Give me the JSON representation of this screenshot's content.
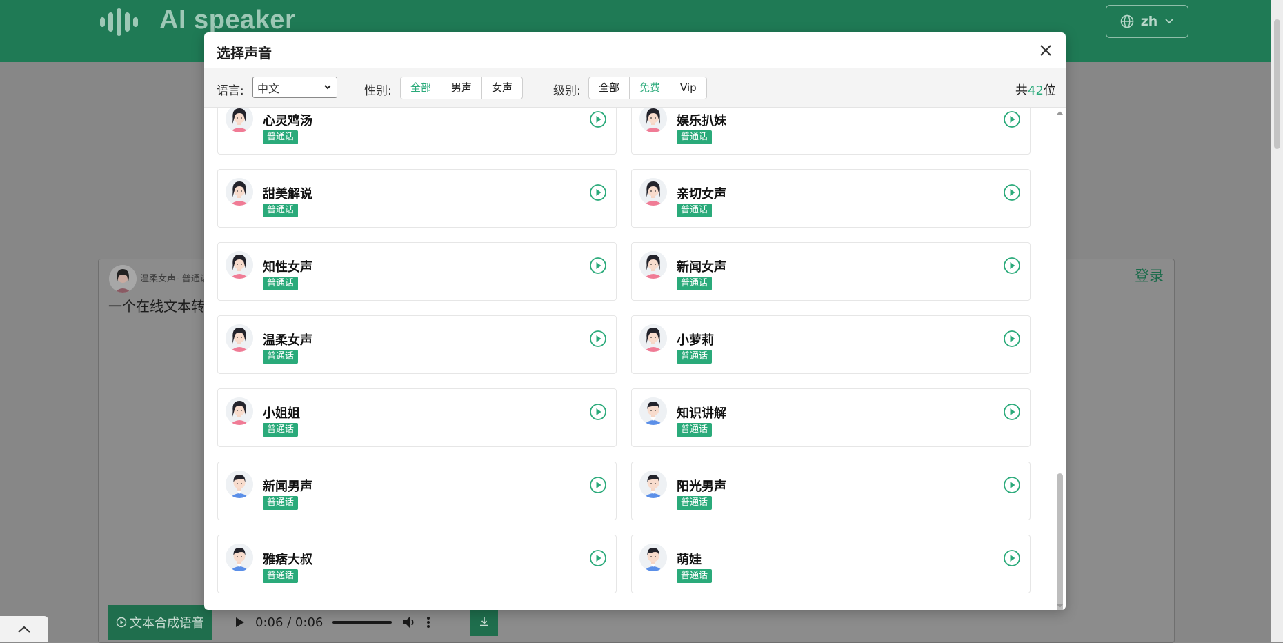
{
  "header": {
    "app_title": "AI speaker",
    "lang_button": "zh"
  },
  "editor": {
    "voice_label": "温柔女声- 普通话",
    "text": "一个在线文本转",
    "login_link": "登录",
    "synth_button": "文本合成语音"
  },
  "player": {
    "time": "0:06 / 0:06"
  },
  "modal": {
    "title": "选择声音",
    "filters": {
      "language_label": "语言:",
      "language_value": "中文",
      "gender_label": "性别:",
      "gender_options": [
        "全部",
        "男声",
        "女声"
      ],
      "gender_selected": "全部",
      "level_label": "级别:",
      "level_options": [
        "全部",
        "免费",
        "Vip"
      ],
      "level_selected": "免费",
      "count_prefix": "共",
      "count_value": "42",
      "count_suffix": "位"
    },
    "voices": [
      {
        "name": "心灵鸡汤",
        "tag": "普通话",
        "gender": "female"
      },
      {
        "name": "娱乐扒妹",
        "tag": "普通话",
        "gender": "female"
      },
      {
        "name": "甜美解说",
        "tag": "普通话",
        "gender": "female"
      },
      {
        "name": "亲切女声",
        "tag": "普通话",
        "gender": "female"
      },
      {
        "name": "知性女声",
        "tag": "普通话",
        "gender": "female"
      },
      {
        "name": "新闻女声",
        "tag": "普通话",
        "gender": "female"
      },
      {
        "name": "温柔女声",
        "tag": "普通话",
        "gender": "female"
      },
      {
        "name": "小萝莉",
        "tag": "普通话",
        "gender": "female"
      },
      {
        "name": "小姐姐",
        "tag": "普通话",
        "gender": "female"
      },
      {
        "name": "知识讲解",
        "tag": "普通话",
        "gender": "male"
      },
      {
        "name": "新闻男声",
        "tag": "普通话",
        "gender": "male"
      },
      {
        "name": "阳光男声",
        "tag": "普通话",
        "gender": "male"
      },
      {
        "name": "雅痞大叔",
        "tag": "普通话",
        "gender": "male"
      },
      {
        "name": "萌娃",
        "tag": "普通话",
        "gender": "male"
      }
    ]
  },
  "colors": {
    "brand": "#1f7a55",
    "accent": "#2aaa7a"
  }
}
